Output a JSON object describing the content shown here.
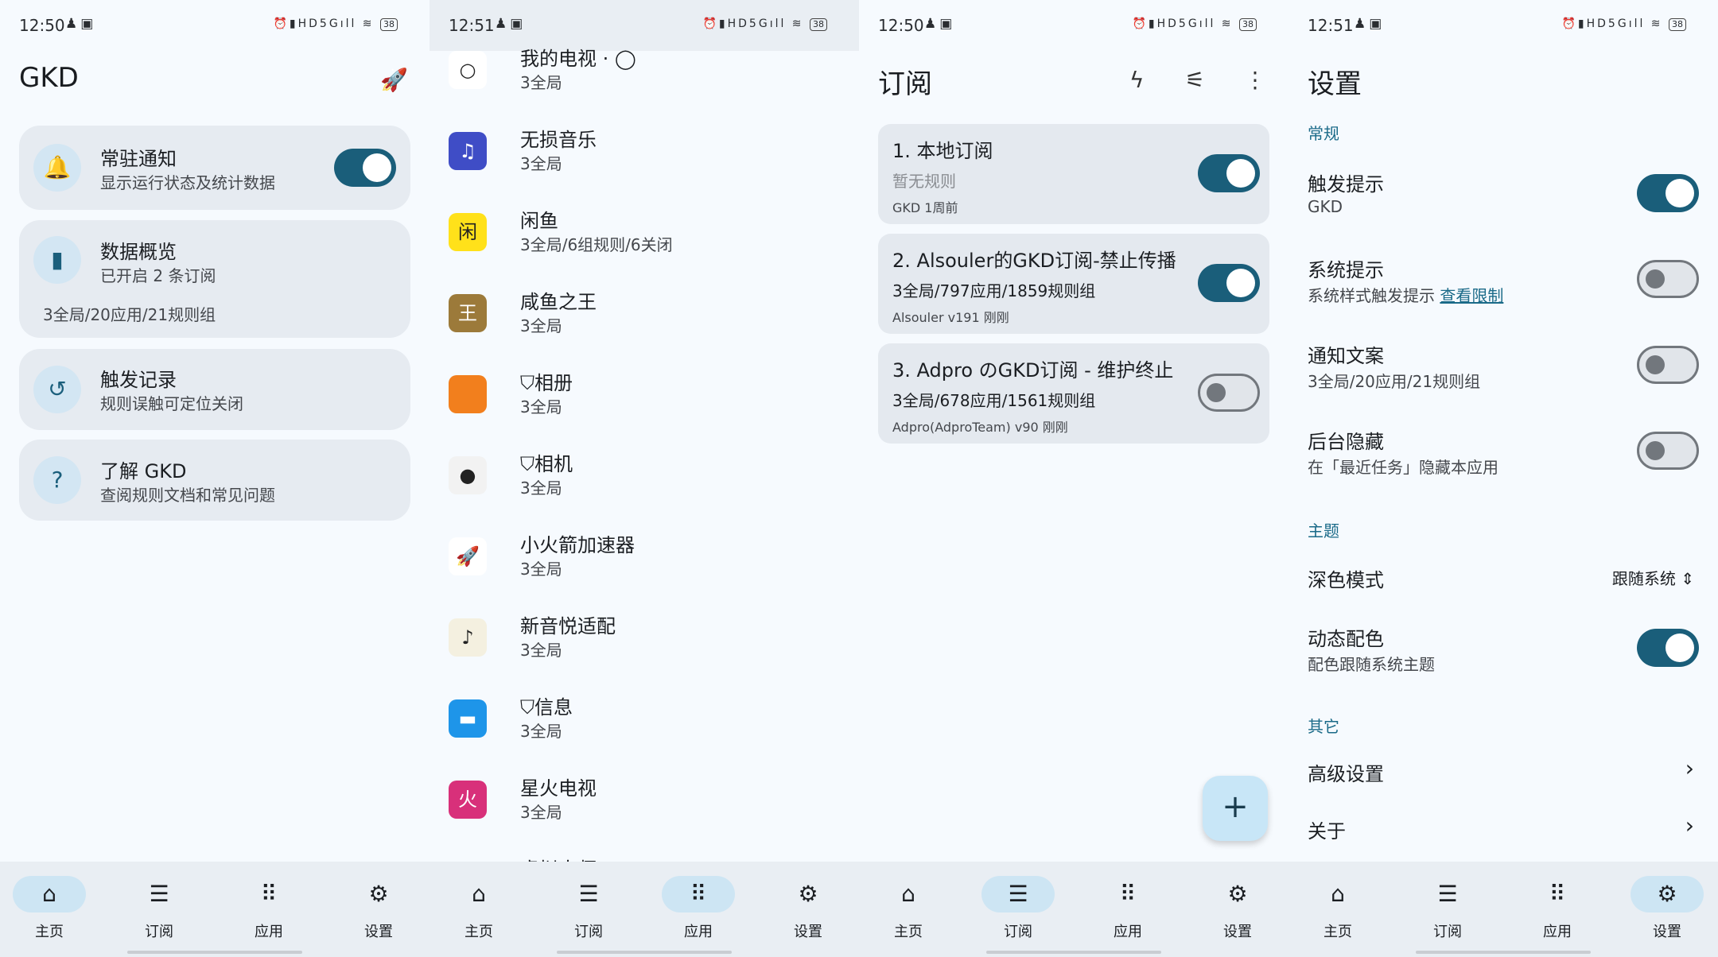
{
  "status": {
    "s1_time": "12:50",
    "s2_time": "12:51",
    "s3_time": "12:50",
    "s4_time": "12:51",
    "battery": "38",
    "network": "5G",
    "hd": "HD"
  },
  "nav": {
    "home": "主页",
    "subs": "订阅",
    "apps": "应用",
    "settings": "设置"
  },
  "home": {
    "title": "GKD",
    "cards": [
      {
        "title": "常驻通知",
        "subtitle": "显示运行状态及统计数据"
      },
      {
        "title": "数据概览",
        "subtitle": "已开启 2 条订阅",
        "extra": "3全局/20应用/21规则组"
      },
      {
        "title": "触发记录",
        "subtitle": "规则误触可定位关闭"
      },
      {
        "title": "了解 GKD",
        "subtitle": "查阅规则文档和常见问题"
      }
    ]
  },
  "apps": {
    "items": [
      {
        "name": "我的电视 · ◯",
        "desc": "3全局",
        "icon_color": "#ffffff",
        "icon": "○"
      },
      {
        "name": "无损音乐",
        "desc": "3全局",
        "icon_color": "#3f4dc6",
        "icon": "♫"
      },
      {
        "name": "闲鱼",
        "desc": "3全局/6组规则/6关闭",
        "icon_color": "#ffe11a",
        "icon": "闲"
      },
      {
        "name": "咸鱼之王",
        "desc": "3全局",
        "icon_color": "#9c7a3a",
        "icon": "王"
      },
      {
        "name": "⛉相册",
        "desc": "3全局",
        "icon_color": "#f27f1d",
        "icon": ""
      },
      {
        "name": "⛉相机",
        "desc": "3全局",
        "icon_color": "#f2f2f2",
        "icon": "●"
      },
      {
        "name": "小火箭加速器",
        "desc": "3全局",
        "icon_color": "#ffffff",
        "icon": "🚀"
      },
      {
        "name": "新音悦适配",
        "desc": "3全局",
        "icon_color": "#f4f0e0",
        "icon": "♪"
      },
      {
        "name": "⛉信息",
        "desc": "3全局",
        "icon_color": "#1e95e9",
        "icon": "▬"
      },
      {
        "name": "星火电视",
        "desc": "3全局",
        "icon_color": "#d8307a",
        "icon": "火"
      }
    ],
    "partial": "虚拟大师"
  },
  "subs": {
    "title": "订阅",
    "fab": "+",
    "items": [
      {
        "title": "1. 本地订阅",
        "line": "暂无规则",
        "meta": "GKD   1周前",
        "on": true
      },
      {
        "title": "2. Alsouler的GKD订阅-禁止传播",
        "line": "3全局/797应用/1859规则组",
        "meta": "Alsouler   v191   刚刚",
        "on": true
      },
      {
        "title": "3. Adpro のGKD订阅 - 维护终止",
        "line": "3全局/678应用/1561规则组",
        "meta": "Adpro(AdproTeam)   v90   刚刚",
        "on": false
      }
    ]
  },
  "settings": {
    "title": "设置",
    "sec_general": "常规",
    "trigger_tip": {
      "title": "触发提示",
      "sub": "GKD"
    },
    "system_tip": {
      "title": "系统提示",
      "sub": "系统样式触发提示",
      "link": "查看限制"
    },
    "notif_text": {
      "title": "通知文案",
      "sub": "3全局/20应用/21规则组"
    },
    "bg_hide": {
      "title": "后台隐藏",
      "sub": "在「最近任务」隐藏本应用"
    },
    "sec_theme": "主题",
    "dark_mode": {
      "title": "深色模式",
      "value": "跟随系统"
    },
    "dynamic_color": {
      "title": "动态配色",
      "sub": "配色跟随系统主题"
    },
    "sec_other": "其它",
    "advanced": "高级设置",
    "about": "关于"
  },
  "colors": {
    "accent": "#1a5e7a",
    "card": "#e6ebf1",
    "nav": "#e9eef3"
  }
}
